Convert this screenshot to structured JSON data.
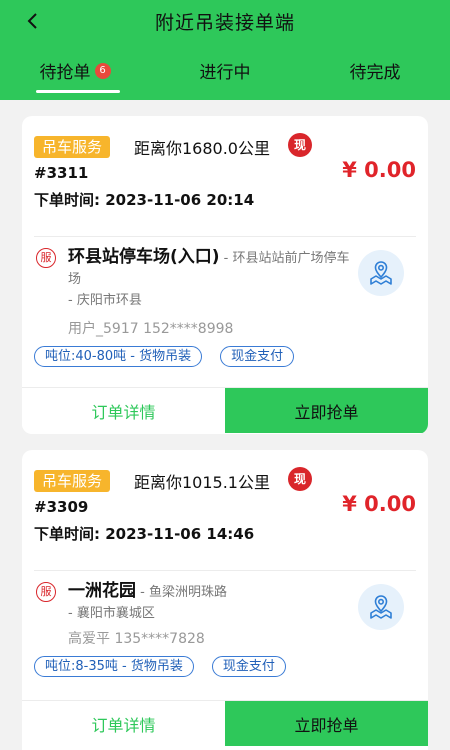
{
  "header": {
    "title": "附近吊装接单端",
    "back_icon": "chevron-left-icon",
    "background": "#2ec85a"
  },
  "tabs": [
    {
      "label": "待抢单",
      "badge": "6",
      "active": true
    },
    {
      "label": "进行中"
    },
    {
      "label": "待完成"
    }
  ],
  "orders": [
    {
      "service_tag": "吊车服务",
      "distance": "距离你1680.0公里",
      "cash_badge": "现",
      "price": "¥ 0.00",
      "order_no": "#3311",
      "order_time": "下单时间:  2023-11-06 20:14",
      "serve_badge": "服",
      "address_main": "环县站停车场(入口)",
      "address_sub": " - 环县站站前广场停车场",
      "address_city": "- 庆阳市环县",
      "customer": "用户_5917   152****8998",
      "chip_tonnage": "吨位:40-80吨 - 货物吊装",
      "chip_payment": "现金支付",
      "detail_label": "订单详情",
      "grab_label": "立即抢单"
    },
    {
      "service_tag": "吊车服务",
      "distance": "距离你1015.1公里",
      "cash_badge": "现",
      "price": "¥ 0.00",
      "order_no": "#3309",
      "order_time": "下单时间:  2023-11-06 14:46",
      "serve_badge": "服",
      "address_main": "一洲花园",
      "address_sub": " - 鱼梁洲明珠路",
      "address_city": "- 襄阳市襄城区",
      "customer": "高爱平   135****7828",
      "chip_tonnage": "吨位:8-35吨 - 货物吊装",
      "chip_payment": "现金支付",
      "detail_label": "订单详情",
      "grab_label": "立即抢单"
    }
  ],
  "colors": {
    "brand_green": "#2ec85a",
    "price_red": "#e0242a",
    "tag_orange": "#f7b52c",
    "chip_blue": "#2160b8"
  }
}
